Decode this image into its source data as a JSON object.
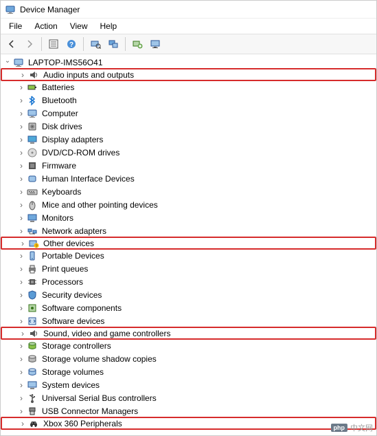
{
  "window": {
    "title": "Device Manager"
  },
  "menu": {
    "file": "File",
    "action": "Action",
    "view": "View",
    "help": "Help"
  },
  "toolbar": {
    "back": "back",
    "forward": "forward",
    "show_hidden": "show",
    "help": "help",
    "scan": "scan",
    "properties": "properties",
    "devices": "devices",
    "monitor": "monitor"
  },
  "tree": {
    "root": {
      "label": "LAPTOP-IMS56O41",
      "icon": "computer-icon",
      "expanded": true,
      "children": [
        {
          "label": "Audio inputs and outputs",
          "icon": "speaker-icon",
          "highlight": true
        },
        {
          "label": "Batteries",
          "icon": "battery-icon"
        },
        {
          "label": "Bluetooth",
          "icon": "bluetooth-icon"
        },
        {
          "label": "Computer",
          "icon": "computer-icon"
        },
        {
          "label": "Disk drives",
          "icon": "disk-icon"
        },
        {
          "label": "Display adapters",
          "icon": "display-icon"
        },
        {
          "label": "DVD/CD-ROM drives",
          "icon": "cdrom-icon"
        },
        {
          "label": "Firmware",
          "icon": "firmware-icon"
        },
        {
          "label": "Human Interface Devices",
          "icon": "hid-icon"
        },
        {
          "label": "Keyboards",
          "icon": "keyboard-icon"
        },
        {
          "label": "Mice and other pointing devices",
          "icon": "mouse-icon"
        },
        {
          "label": "Monitors",
          "icon": "monitor-icon"
        },
        {
          "label": "Network adapters",
          "icon": "network-icon"
        },
        {
          "label": "Other devices",
          "icon": "other-icon",
          "highlight": true
        },
        {
          "label": "Portable Devices",
          "icon": "portable-icon"
        },
        {
          "label": "Print queues",
          "icon": "printer-icon"
        },
        {
          "label": "Processors",
          "icon": "cpu-icon"
        },
        {
          "label": "Security devices",
          "icon": "security-icon"
        },
        {
          "label": "Software components",
          "icon": "software-icon"
        },
        {
          "label": "Software devices",
          "icon": "software-dev-icon"
        },
        {
          "label": "Sound, video and game controllers",
          "icon": "sound-icon",
          "highlight": true
        },
        {
          "label": "Storage controllers",
          "icon": "storage-icon"
        },
        {
          "label": "Storage volume shadow copies",
          "icon": "shadow-icon"
        },
        {
          "label": "Storage volumes",
          "icon": "volume-icon"
        },
        {
          "label": "System devices",
          "icon": "system-icon"
        },
        {
          "label": "Universal Serial Bus controllers",
          "icon": "usb-icon"
        },
        {
          "label": "USB Connector Managers",
          "icon": "usb-connector-icon"
        },
        {
          "label": "Xbox 360 Peripherals",
          "icon": "xbox-icon",
          "highlight": true
        }
      ]
    }
  },
  "watermark": {
    "badge": "php",
    "text": "中文网"
  }
}
